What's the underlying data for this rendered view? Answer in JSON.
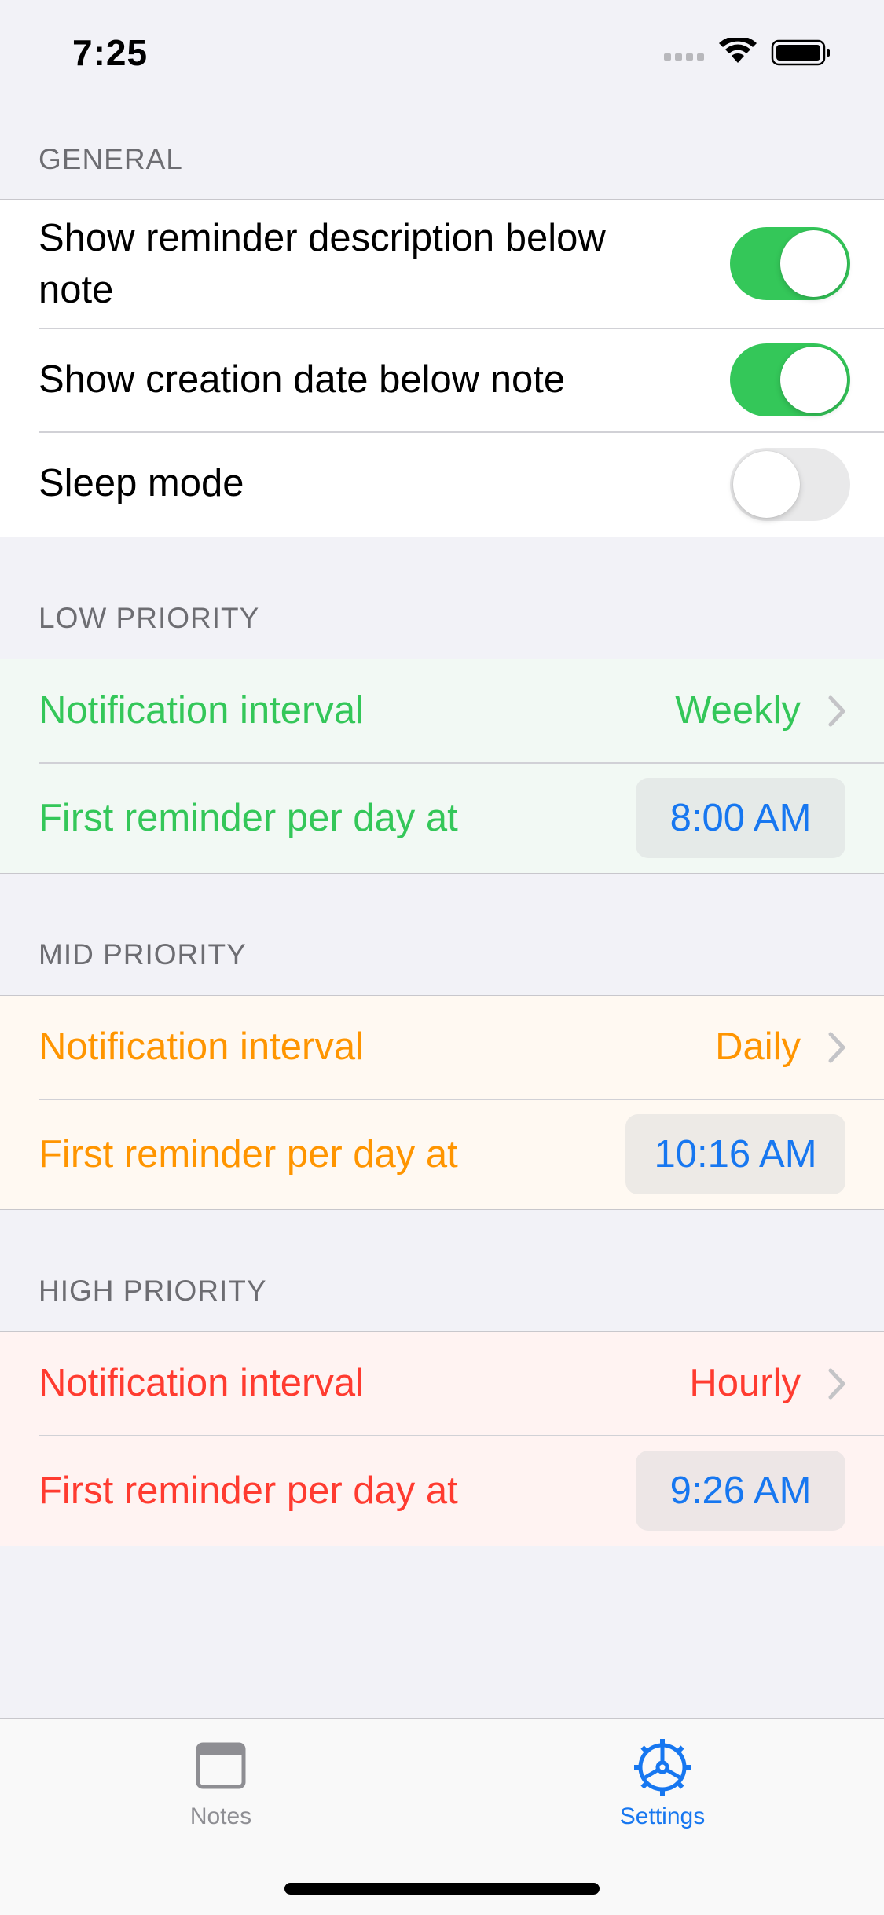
{
  "status_bar": {
    "time": "7:25"
  },
  "general": {
    "header": "GENERAL",
    "rows": [
      {
        "label": "Show reminder description below\nnote",
        "toggle_on": true
      },
      {
        "label": "Show creation date below note",
        "toggle_on": true
      },
      {
        "label": "Sleep mode",
        "toggle_on": false
      }
    ]
  },
  "low": {
    "header": "LOW PRIORITY",
    "color": "#34c759",
    "tint": "#f2f9f4",
    "interval_label": "Notification interval",
    "interval_value": "Weekly",
    "first_label": "First reminder per day at",
    "first_time": "8:00 AM"
  },
  "mid": {
    "header": "MID PRIORITY",
    "color": "#ff9500",
    "tint": "#fff9f2",
    "interval_label": "Notification interval",
    "interval_value": "Daily",
    "first_label": "First reminder per day at",
    "first_time": "10:16 AM"
  },
  "high": {
    "header": "HIGH PRIORITY",
    "color": "#ff3b30",
    "tint": "#fff3f2",
    "interval_label": "Notification interval",
    "interval_value": "Hourly",
    "first_label": "First reminder per day at",
    "first_time": "9:26 AM"
  },
  "tab_bar": {
    "tabs": [
      {
        "label": "Notes",
        "icon": "window-icon",
        "active": false
      },
      {
        "label": "Settings",
        "icon": "gear-icon",
        "active": true
      }
    ],
    "active_color": "#1777f0",
    "inactive_color": "#8e8e93"
  }
}
